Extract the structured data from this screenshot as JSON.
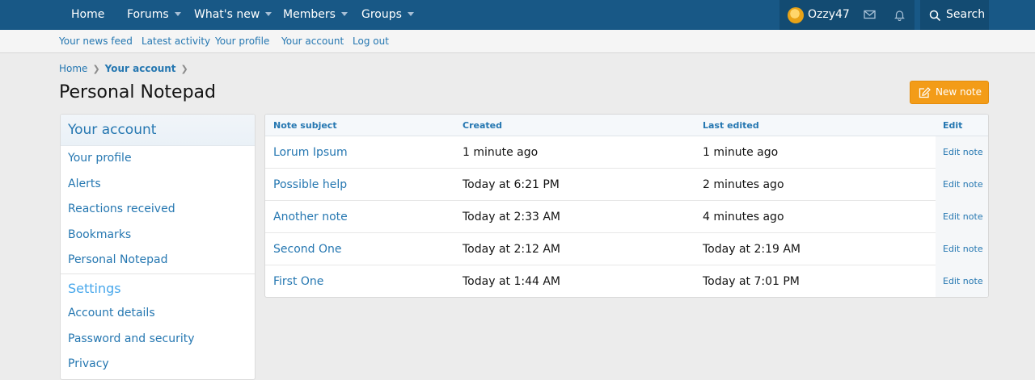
{
  "topnav": {
    "home": "Home",
    "forums": "Forums",
    "whats_new": "What's new",
    "members": "Members",
    "groups": "Groups",
    "username": "Ozzy47",
    "search": "Search"
  },
  "subnav": {
    "items": [
      "Your news feed",
      "Latest activity",
      "Your profile",
      "Your account",
      "Log out"
    ]
  },
  "breadcrumb": {
    "home": "Home",
    "current": "Your account"
  },
  "page": {
    "title": "Personal Notepad",
    "new_note": "New note"
  },
  "sidebar": {
    "account_title": "Your account",
    "account_items": [
      "Your profile",
      "Alerts",
      "Reactions received",
      "Bookmarks",
      "Personal Notepad"
    ],
    "settings_title": "Settings",
    "settings_items": [
      "Account details",
      "Password and security",
      "Privacy"
    ]
  },
  "table": {
    "headers": {
      "subject": "Note subject",
      "created": "Created",
      "last_edited": "Last edited",
      "edit": "Edit"
    },
    "rows": [
      {
        "subject": "Lorum Ipsum",
        "created": "1 minute ago",
        "last_edited": "1 minute ago",
        "edit": "Edit note"
      },
      {
        "subject": "Possible help",
        "created": "Today at 6:21 PM",
        "last_edited": "2 minutes ago",
        "edit": "Edit note"
      },
      {
        "subject": "Another note",
        "created": "Today at 2:33 AM",
        "last_edited": "4 minutes ago",
        "edit": "Edit note"
      },
      {
        "subject": "Second One",
        "created": "Today at 2:12 AM",
        "last_edited": "Today at 2:19 AM",
        "edit": "Edit note"
      },
      {
        "subject": "First One",
        "created": "Today at 1:44 AM",
        "last_edited": "Today at 7:01 PM",
        "edit": "Edit note"
      }
    ]
  },
  "colors": {
    "header_bg": "#185886",
    "link": "#2577b1",
    "button": "#f39c18"
  }
}
